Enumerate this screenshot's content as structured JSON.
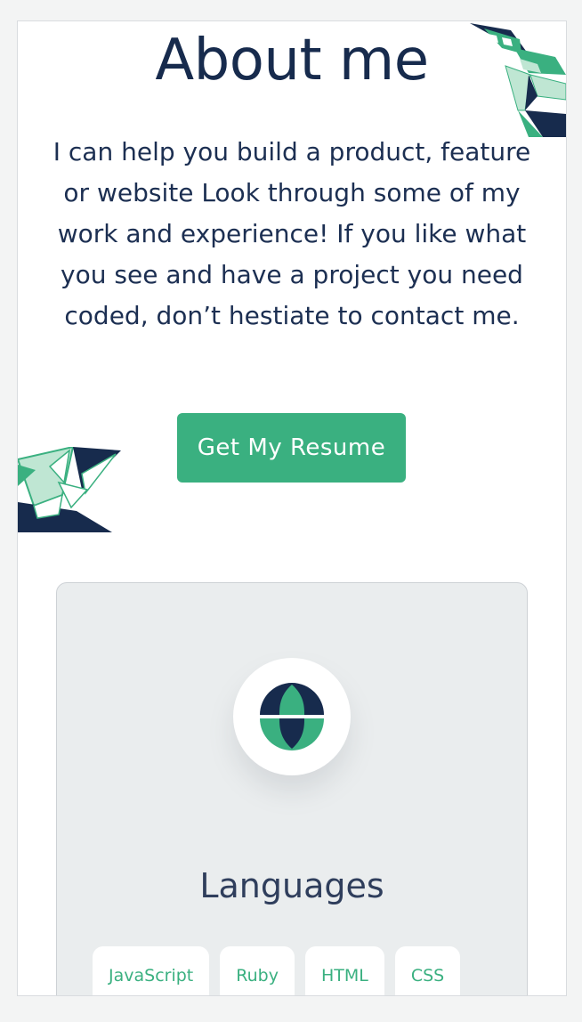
{
  "about": {
    "title": "About me",
    "intro": "I can help you build a product, feature or website Look through some of my work and experience! If you like what you see and have a project you need coded, don’t hestiate to contact me.",
    "resume_button": "Get My Resume"
  },
  "skills_card": {
    "icon": "globe-icon",
    "title": "Languages",
    "tags": [
      "JavaScript",
      "Ruby",
      "HTML",
      "CSS"
    ]
  },
  "colors": {
    "navy": "#172b4d",
    "green": "#3ab080",
    "light_green": "#bfe6d3",
    "card_bg": "#eaedee"
  }
}
